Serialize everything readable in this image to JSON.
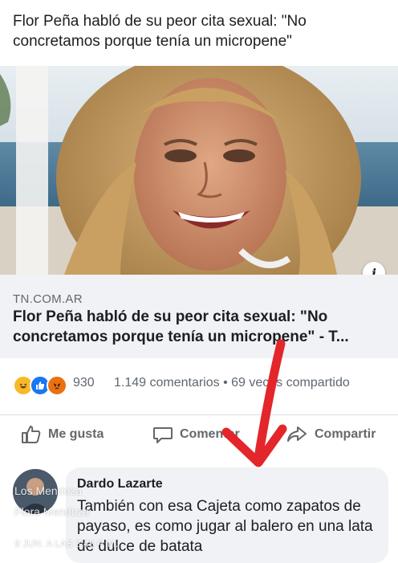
{
  "post": {
    "text": "Flor Peña habló de su peor cita sexual: \"No concretamos porque tenía un micropene\""
  },
  "link_preview": {
    "domain": "TN.COM.AR",
    "title": "Flor Peña habló de su peor cita sexual: \"No concretamos porque tenía un micropene\" - T..."
  },
  "stats": {
    "reactions": [
      "haha-icon",
      "like-icon",
      "angry-icon"
    ],
    "reaction_count": "930",
    "comments_shares": "1.149 comentarios • 69 veces compartido"
  },
  "actions": {
    "like_label": "Me gusta",
    "comment_label": "Comentar",
    "share_label": "Compartir"
  },
  "comment": {
    "author": "Dardo Lazarte",
    "text": "También con esa Cajeta como zapatos de payaso, es como jugar al balero en una lata de dulce de batata"
  },
  "watermark": {
    "name": "Los Mendoza",
    "page": "Flora Mendoza",
    "date": "9 JUN. A LAS 3:48 P. M."
  },
  "colors": {
    "annotation_arrow": "#e3262b",
    "accent": "#1877f2"
  }
}
